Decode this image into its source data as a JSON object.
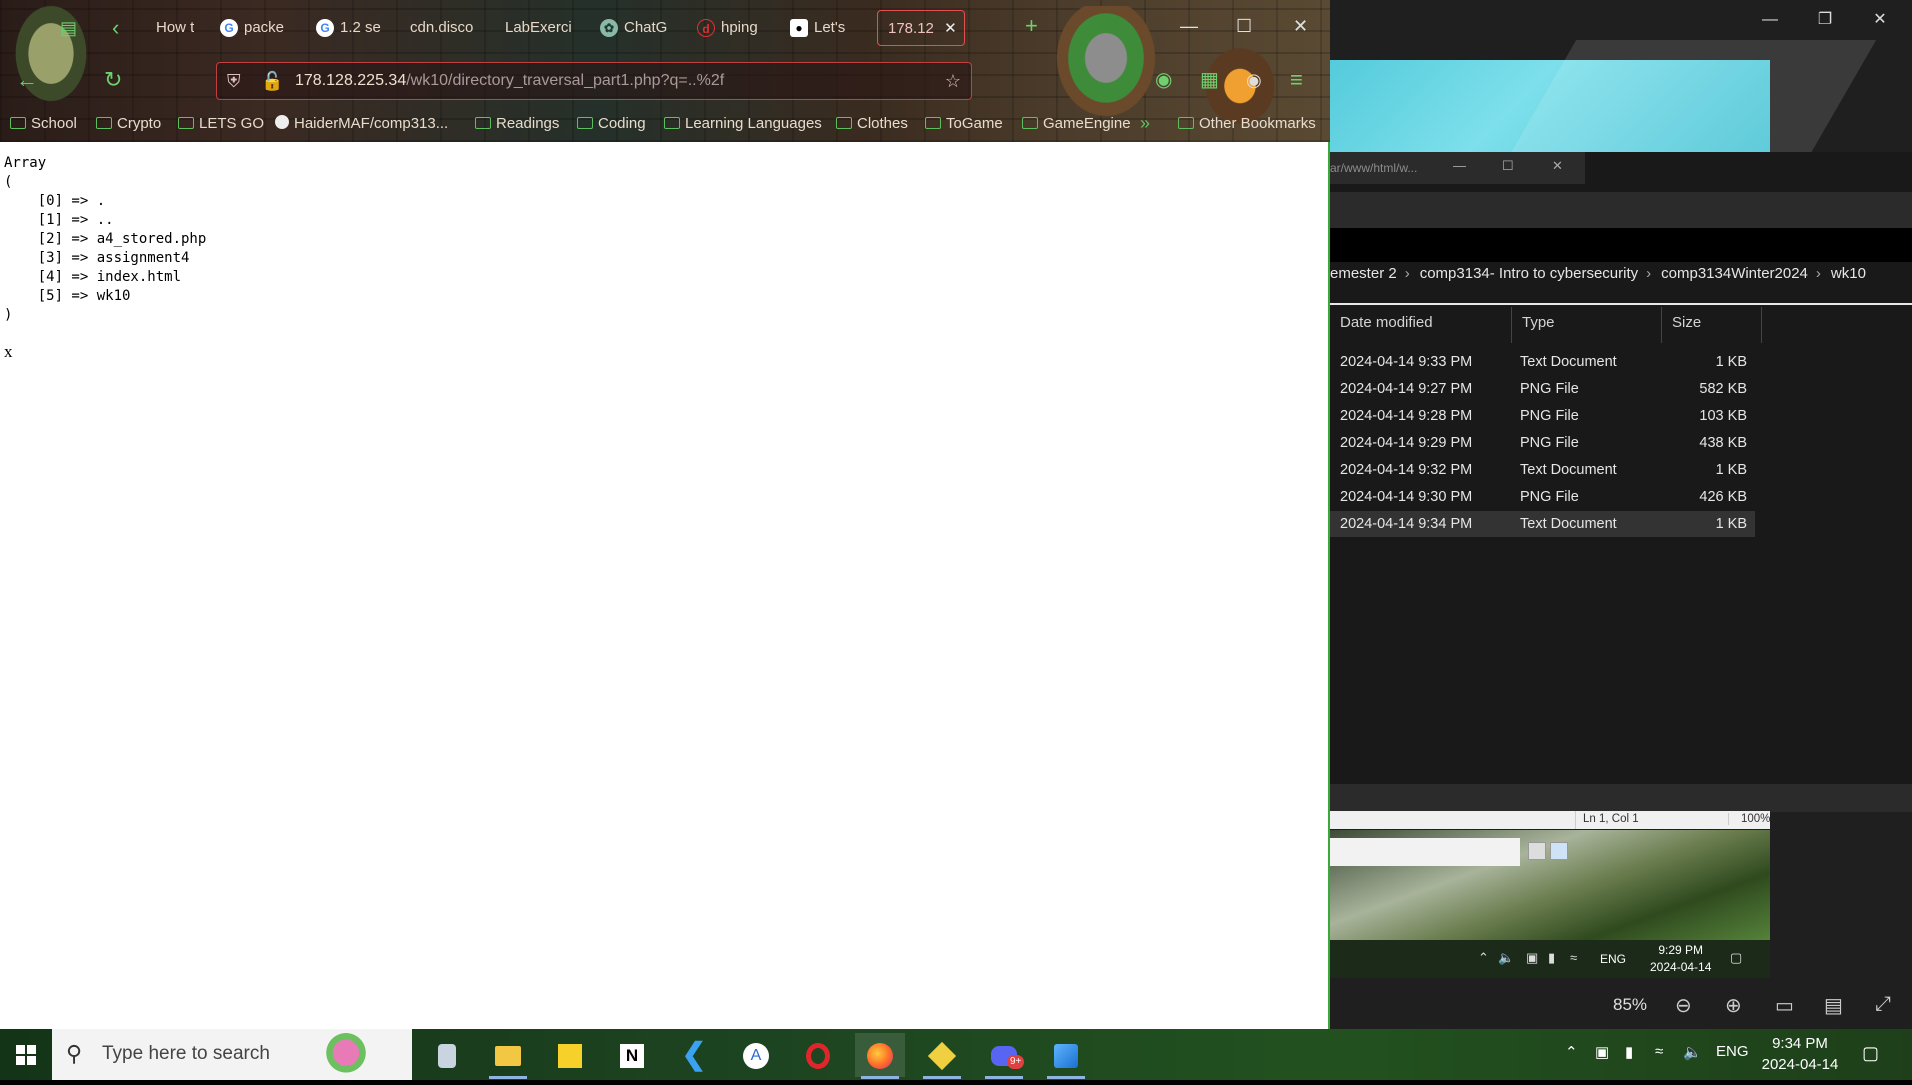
{
  "browser": {
    "tabs": [
      {
        "title": "How t",
        "favicon": "generic-page-icon"
      },
      {
        "title": "packe",
        "favicon": "google-icon"
      },
      {
        "title": "1.2 se",
        "favicon": "google-icon"
      },
      {
        "title": "cdn.disco",
        "favicon": "generic-page-icon"
      },
      {
        "title": "LabExerci",
        "favicon": "generic-page-icon"
      },
      {
        "title": "ChatG",
        "favicon": "chatgpt-icon"
      },
      {
        "title": "hping",
        "favicon": "generic-page-icon"
      },
      {
        "title": "Let's",
        "favicon": "medium-icon"
      },
      {
        "title": "178.12",
        "favicon": "generic-page-icon",
        "active": true
      }
    ],
    "url": {
      "host": "178.128.225.34",
      "path": "/wk10/directory_traversal_part1.php?q=..%2f"
    },
    "bookmarks": [
      "School",
      "Crypto",
      "LETS GO",
      "HaiderMAF/comp313...",
      "Readings",
      "Coding",
      "Learning Languages",
      "Clothes",
      "ToGame",
      "GameEngine",
      "Other Bookmarks"
    ],
    "page": {
      "output": "Array\n(\n    [0] => .\n    [1] => ..\n    [2] => a4_stored.php\n    [3] => assignment4\n    [4] => index.html\n    [5] => wk10\n)",
      "trailing": "x"
    }
  },
  "explorer": {
    "mini_title": "ar/www/html/w...",
    "breadcrumb": [
      "emester 2",
      "comp3134- Intro to cybersecurity",
      "comp3134Winter2024",
      "wk10"
    ],
    "columns": [
      "Date modified",
      "Type",
      "Size"
    ],
    "rows": [
      {
        "date": "2024-04-14 9:33 PM",
        "type": "Text Document",
        "size": "1 KB"
      },
      {
        "date": "2024-04-14 9:27 PM",
        "type": "PNG File",
        "size": "582 KB"
      },
      {
        "date": "2024-04-14 9:28 PM",
        "type": "PNG File",
        "size": "103 KB"
      },
      {
        "date": "2024-04-14 9:29 PM",
        "type": "PNG File",
        "size": "438 KB"
      },
      {
        "date": "2024-04-14 9:32 PM",
        "type": "Text Document",
        "size": "1 KB"
      },
      {
        "date": "2024-04-14 9:30 PM",
        "type": "PNG File",
        "size": "426 KB"
      },
      {
        "date": "2024-04-14 9:34 PM",
        "type": "Text Document",
        "size": "1 KB"
      }
    ]
  },
  "notepad": {
    "position": "Ln 1, Col 1",
    "zoom": "100%"
  },
  "mini_taskbar": {
    "lang": "ENG",
    "time": "9:29 PM",
    "date": "2024-04-14"
  },
  "photos": {
    "zoom": "85%"
  },
  "taskbar": {
    "search_placeholder": "Type here to search",
    "lang": "ENG",
    "time": "9:34 PM",
    "date": "2024-04-14",
    "apps": [
      "disk-icon",
      "file-explorer-icon",
      "sticky-notes-icon",
      "notion-icon",
      "vscode-icon",
      "app-store-icon",
      "opera-icon",
      "firefox-icon",
      "git-icon",
      "discord-icon",
      "photos-icon"
    ],
    "discord_badge": "9+"
  },
  "colors": {
    "accent": "#3aa83a",
    "active_tab": "#e05050"
  }
}
